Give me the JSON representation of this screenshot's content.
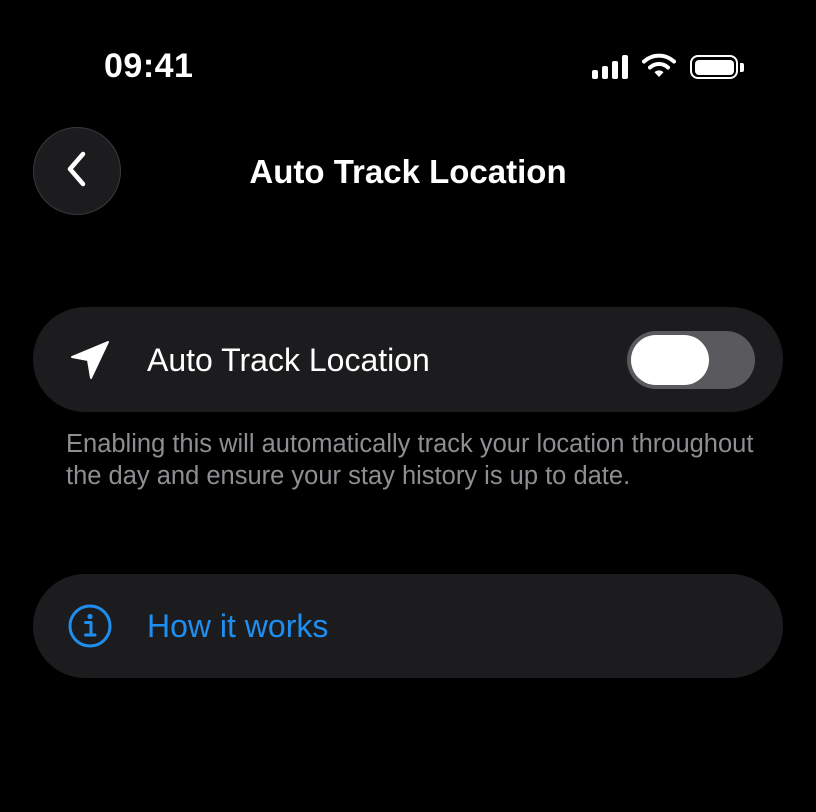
{
  "status_bar": {
    "time": "09:41",
    "signal_icon": "signal-bars-icon",
    "wifi_icon": "wifi-icon",
    "battery_icon": "battery-icon",
    "battery_level": 1.0
  },
  "header": {
    "back_icon": "chevron-left-icon",
    "title": "Auto Track Location"
  },
  "auto_track": {
    "icon": "location-arrow-icon",
    "label": "Auto Track Location",
    "enabled": false,
    "description": "Enabling this will automatically track your location throughout the day and ensure your stay history is up to date."
  },
  "info": {
    "icon": "info-circle-icon",
    "label": "How it works",
    "color": "#1e8ff0"
  },
  "colors": {
    "background": "#000000",
    "card": "#1c1c1e",
    "toggle_off_track": "#5a5a5e",
    "secondary_text": "#8e8e93",
    "accent": "#1e8ff0"
  }
}
